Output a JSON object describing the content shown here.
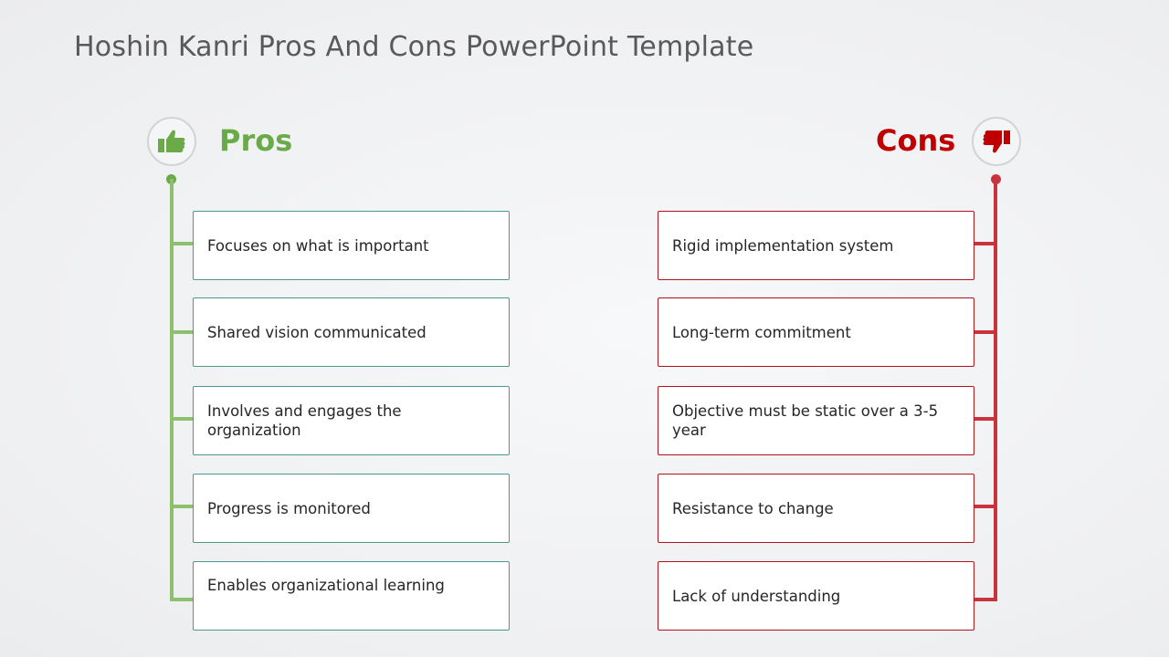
{
  "title": "Hoshin Kanri Pros And Cons PowerPoint Template",
  "colors": {
    "pros_accent": "#6aaa48",
    "cons_accent": "#c00000",
    "pros_card_border": "#4a9a8a",
    "cons_card_border": "#b0121e"
  },
  "pros": {
    "heading": "Pros",
    "icon": "thumbs-up-icon",
    "items": [
      "Focuses on what is important",
      "Shared vision communicated",
      "Involves and engages the organization",
      "Progress is monitored",
      "Enables organizational learning"
    ]
  },
  "cons": {
    "heading": "Cons",
    "icon": "thumbs-down-icon",
    "items": [
      "Rigid implementation system",
      "Long-term commitment",
      "Objective must be static over a 3-5 year",
      "Resistance to change",
      "Lack of understanding"
    ]
  }
}
